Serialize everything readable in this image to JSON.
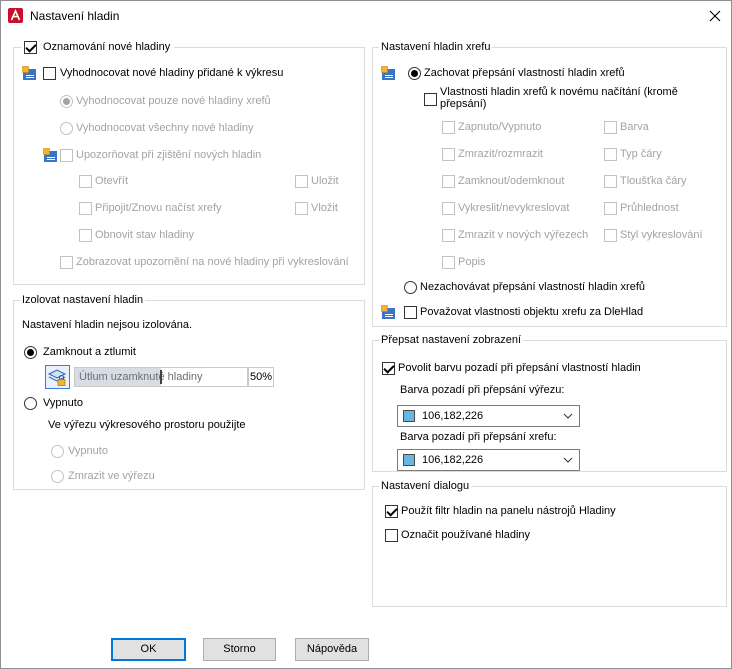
{
  "window": {
    "title": "Nastavení hladin"
  },
  "icons": {
    "app": "autocad-icon",
    "close": "close-icon",
    "layer": "layer-notification-icon",
    "lock_fade": "layer-lock-fade-icon",
    "dropdown": "chevron-down-icon"
  },
  "new_layers": {
    "title": {
      "label": "Oznamování nové hladiny",
      "checked": true
    },
    "evaluate": {
      "label": "Vyhodnocovat nové hladiny přidané k výkresu",
      "checked": false
    },
    "eval_xref_only": {
      "label": "Vyhodnocovat pouze nové hladiny xrefů",
      "selected": true,
      "disabled": true
    },
    "eval_all": {
      "label": "Vyhodnocovat všechny nové hladiny",
      "selected": false,
      "disabled": true
    },
    "notify": {
      "label": "Upozorňovat při zjištění nových hladin",
      "checked": false,
      "disabled": true
    },
    "open": {
      "label": "Otevřít",
      "checked": false,
      "disabled": true
    },
    "save": {
      "label": "Uložit",
      "checked": false,
      "disabled": true
    },
    "attach_reload": {
      "label": "Připojit/Znovu načíst xrefy",
      "checked": false,
      "disabled": true
    },
    "insert": {
      "label": "Vložit",
      "checked": false,
      "disabled": true
    },
    "restore_state": {
      "label": "Obnovit stav hladiny",
      "checked": false,
      "disabled": true
    },
    "plot_warning": {
      "label": "Zobrazovat upozornění na nové hladiny při vykreslování",
      "checked": false,
      "disabled": true
    }
  },
  "isolate": {
    "title": "Izolovat nastavení hladin",
    "status": "Nastavení hladin nejsou izolována.",
    "lock_and_fade": {
      "label": "Zamknout a ztlumit",
      "selected": true
    },
    "fade": {
      "label": "Útlum uzamknuté hladiny",
      "value_text": "50%",
      "level_percent": 50
    },
    "off": {
      "label": "Vypnuto",
      "selected": false
    },
    "viewport_note": "Ve výřezu výkresového prostoru použijte",
    "vp_off": {
      "label": "Vypnuto",
      "selected": false,
      "disabled": true
    },
    "vp_freeze": {
      "label": "Zmrazit ve výřezu",
      "selected": false,
      "disabled": true
    }
  },
  "xref": {
    "title": "Nastavení hladin xrefu",
    "keep_overrides": {
      "label": "Zachovat přepsání vlastností hladin xrefů",
      "selected": true
    },
    "reload_props": {
      "label": "Vlastnosti hladin xrefů k novému načítání (kromě přepsání)",
      "checked": false
    },
    "on_off": {
      "label": "Zapnuto/Vypnuto",
      "checked": false,
      "disabled": true
    },
    "color": {
      "label": "Barva",
      "checked": false,
      "disabled": true
    },
    "freeze_thaw": {
      "label": "Zmrazit/rozmrazit",
      "checked": false,
      "disabled": true
    },
    "linetype": {
      "label": "Typ čáry",
      "checked": false,
      "disabled": true
    },
    "lock_unlock": {
      "label": "Zamknout/odemknout",
      "checked": false,
      "disabled": true
    },
    "lineweight": {
      "label": "Tloušťka čáry",
      "checked": false,
      "disabled": true
    },
    "plot": {
      "label": "Vykreslit/nevykreslovat",
      "checked": false,
      "disabled": true
    },
    "transparency": {
      "label": "Průhlednost",
      "checked": false,
      "disabled": true
    },
    "new_vp_freeze": {
      "label": "Zmrazit v nových výřezech",
      "checked": false,
      "disabled": true
    },
    "plot_style": {
      "label": "Styl vykreslování",
      "checked": false,
      "disabled": true
    },
    "description": {
      "label": "Popis",
      "checked": false,
      "disabled": true
    },
    "discard_overrides": {
      "label": "Nezachovávat přepsání vlastností hladin xrefů",
      "selected": false
    },
    "bylayer": {
      "label": "Považovat vlastnosti objektu xrefu za DleHlad",
      "checked": false
    }
  },
  "display_override": {
    "title": "Přepsat nastavení zobrazení",
    "bg_color": {
      "label": "Povolit barvu pozadí při přepsání vlastností hladin",
      "checked": true
    },
    "viewport_label": "Barva pozadí při přepsání výřezu:",
    "viewport_color": {
      "value": "106,182,226",
      "swatch": "#6AB6E2"
    },
    "xref_label": "Barva pozadí při přepsání xrefu:",
    "xref_color": {
      "value": "106,182,226",
      "swatch": "#6AB6E2"
    }
  },
  "dialog_settings": {
    "title": "Nastavení dialogu",
    "apply_filter": {
      "label": "Použít filtr hladin na panelu nástrojů Hladiny",
      "checked": true
    },
    "indicate_used": {
      "label": "Označit používané hladiny",
      "checked": false
    }
  },
  "buttons": {
    "ok": "OK",
    "cancel": "Storno",
    "help": "Nápověda"
  }
}
